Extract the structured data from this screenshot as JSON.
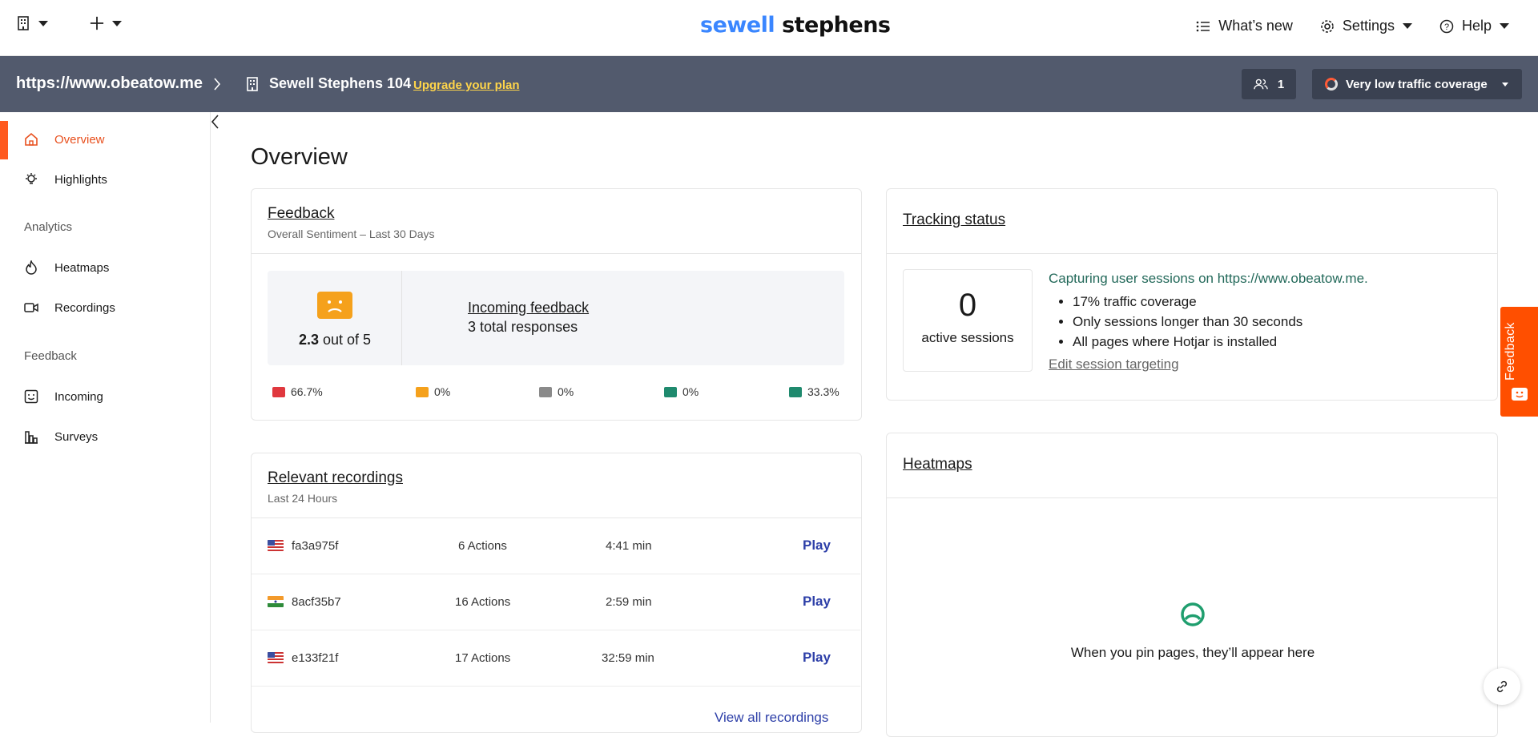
{
  "topnav": {
    "logo_a": "sewell",
    "logo_b": "stephens",
    "whats_new": "What’s new",
    "settings": "Settings",
    "help": "Help"
  },
  "sitebar": {
    "url": "https://www.obeatow.me",
    "org": "Sewell Stephens 104",
    "upgrade": "Upgrade your plan",
    "users_count": "1",
    "traffic": "Very low traffic coverage"
  },
  "sidebar": {
    "items": [
      {
        "label": "Overview"
      },
      {
        "label": "Highlights"
      },
      {
        "label": "Heatmaps"
      },
      {
        "label": "Recordings"
      },
      {
        "label": "Incoming"
      },
      {
        "label": "Surveys"
      }
    ],
    "sections": [
      "Analytics",
      "Feedback"
    ]
  },
  "page": {
    "title": "Overview"
  },
  "feedback": {
    "title": "Feedback",
    "subtitle": "Overall Sentiment – Last 30 Days",
    "score": "2.3",
    "score_suffix": " out of 5",
    "incoming_link": "Incoming feedback",
    "responses": "3 total responses",
    "distribution": [
      "66.7%",
      "0%",
      "0%",
      "0%",
      "33.3%"
    ],
    "colors": [
      "#e0383e",
      "#f5a11c",
      "#8a8a8a",
      "#1f8a6e",
      "#1f8a6e"
    ]
  },
  "recordings": {
    "title": "Relevant recordings",
    "subtitle": "Last 24 Hours",
    "rows": [
      {
        "id": "fa3a975f",
        "actions": "6 Actions",
        "duration": "4:41 min",
        "play": "Play",
        "flag": "us"
      },
      {
        "id": "8acf35b7",
        "actions": "16 Actions",
        "duration": "2:59 min",
        "play": "Play",
        "flag": "in"
      },
      {
        "id": "e133f21f",
        "actions": "17 Actions",
        "duration": "32:59 min",
        "play": "Play",
        "flag": "us"
      }
    ],
    "view_all": "View all recordings"
  },
  "tracking": {
    "title": "Tracking status",
    "count": "0",
    "count_label": "active sessions",
    "capturing": "Capturing user sessions on https://www.obeatow.me.",
    "bullets": [
      "17% traffic coverage",
      "Only sessions longer than 30 seconds",
      "All pages where Hotjar is installed"
    ],
    "edit": "Edit session targeting"
  },
  "heatmaps": {
    "title": "Heatmaps",
    "empty": "When you pin pages, they’ll appear here"
  },
  "feedback_tab": {
    "label": "Feedback"
  }
}
